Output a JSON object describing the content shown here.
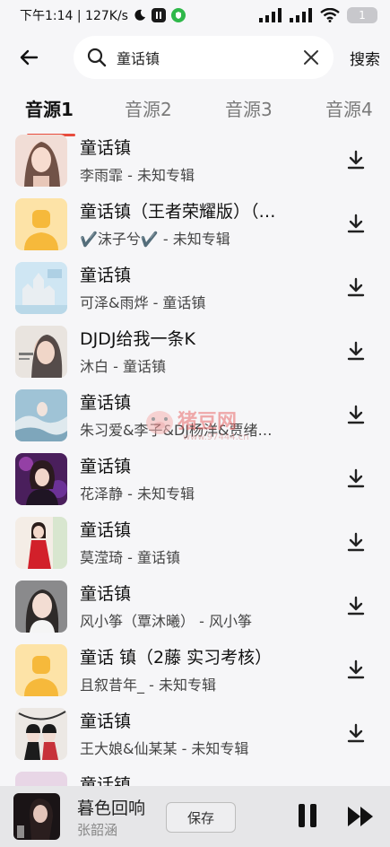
{
  "status_bar": {
    "left_text": "下午1:14 | 127K/s",
    "battery": "1"
  },
  "search": {
    "query": "童话镇",
    "button_label": "搜索"
  },
  "tabs": [
    "音源1",
    "音源2",
    "音源3",
    "音源4"
  ],
  "songs": [
    {
      "title": "童话镇",
      "subtitle": "李雨霏 - 未知专辑"
    },
    {
      "title": "童话镇（王者荣耀版）（…",
      "subtitle": "✔️沫子兮✔️ - 未知专辑"
    },
    {
      "title": "童话镇",
      "subtitle": "可泽&雨烨 - 童话镇"
    },
    {
      "title": "DJDJ给我一条K",
      "subtitle": "沐白 - 童话镇"
    },
    {
      "title": "童话镇",
      "subtitle": "朱习爱&李子&DJ杨洋&贾绪…"
    },
    {
      "title": "童话镇",
      "subtitle": "花泽静 - 未知专辑"
    },
    {
      "title": "童话镇",
      "subtitle": "莫滢琦 - 童话镇"
    },
    {
      "title": "童话镇",
      "subtitle": "风小筝（覃沐曦） - 风小筝"
    },
    {
      "title": "童话 镇（2藤 实习考核）",
      "subtitle": "且叙昔年_ - 未知专辑"
    },
    {
      "title": "童话镇",
      "subtitle": "王大娘&仙某某 - 未知专辑"
    },
    {
      "title": "童话镇",
      "subtitle": ""
    }
  ],
  "watermark": {
    "brand": "猪豆网",
    "url": "www.97444.cn"
  },
  "player": {
    "title": "暮色回响",
    "artist": "张韶涵",
    "save_label": "保存"
  },
  "colors": {
    "accent": "#e84c3d",
    "background": "#f6f6f8",
    "placeholder_cover": "#fde3a7",
    "placeholder_face": "#f6b93b"
  }
}
